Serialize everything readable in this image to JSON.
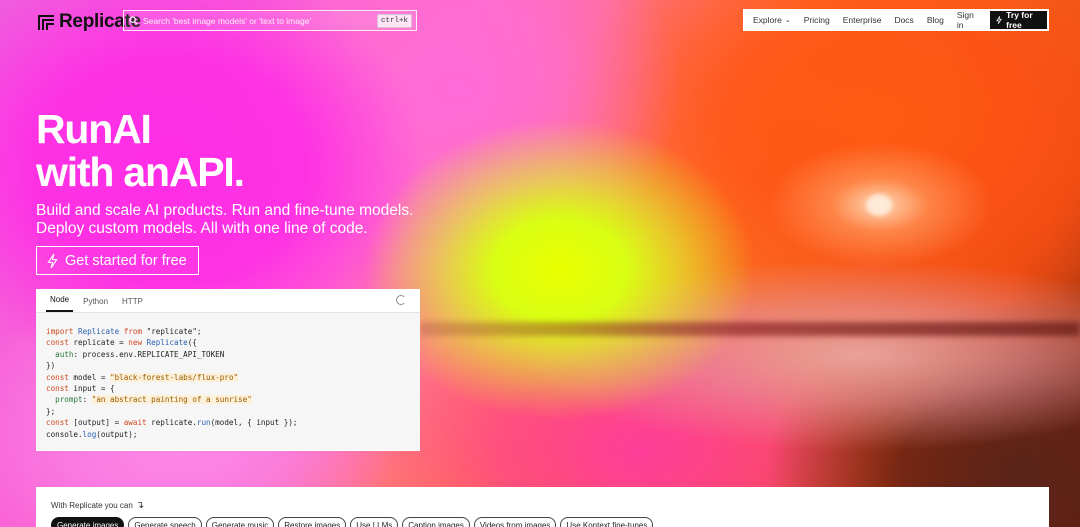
{
  "header": {
    "logo_text": "Replicate",
    "search": {
      "placeholder": "Search 'best image models' or 'text to image'",
      "shortcut": "ctrl+k"
    },
    "nav": [
      {
        "label": "Explore",
        "has_dropdown": true
      },
      {
        "label": "Pricing"
      },
      {
        "label": "Enterprise"
      },
      {
        "label": "Docs"
      },
      {
        "label": "Blog"
      },
      {
        "label": "Sign in"
      }
    ],
    "cta_label": "Try for free"
  },
  "hero": {
    "title_line1": "RunAI",
    "title_line2": "with anAPI.",
    "subtitle_line1": "Build and scale AI products. Run and fine-tune models.",
    "subtitle_line2": "Deploy custom models. All with one line of code.",
    "cta_label": "Get started for free"
  },
  "code": {
    "tabs": [
      "Node",
      "Python",
      "HTTP"
    ],
    "active_tab": "Node"
  },
  "use_cases": {
    "label": "With Replicate you can",
    "chips": [
      "Generate images",
      "Generate speech",
      "Generate music",
      "Restore images",
      "Use LLMs",
      "Caption images",
      "Videos from images",
      "Use Kontext fine-tunes"
    ],
    "active_chip": "Generate images"
  },
  "colors": {
    "accent_dark": "#111111",
    "string_color": "#9a5b00",
    "keyword_color": "#d1451d"
  }
}
